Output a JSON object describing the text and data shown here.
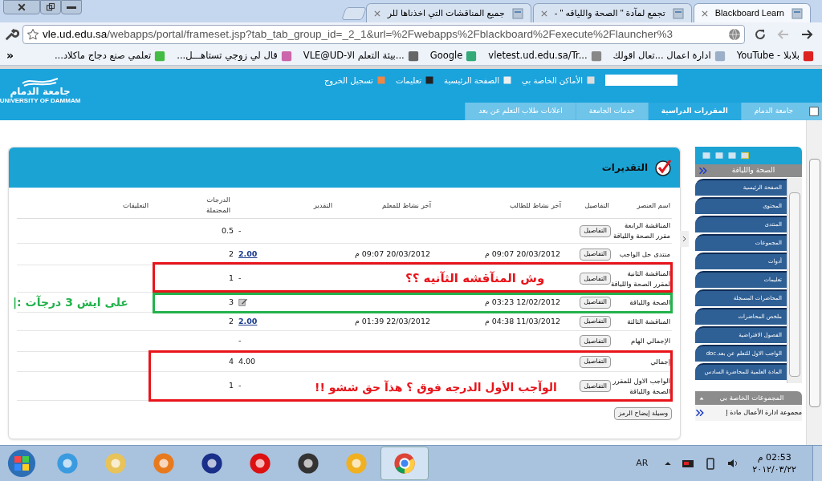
{
  "browser_tabs": [
    {
      "label": "Blackboard Learn",
      "selected": true
    },
    {
      "label": "تجمع لمآدة \" الصحة واللياقه \" - ",
      "selected": false
    },
    {
      "label": "جميع المناقشات التي اخذناها للر",
      "selected": false
    }
  ],
  "address": {
    "host": "vle.ud.edu.sa",
    "path": "/webapps/portal/frameset.jsp?tab_tab_group_id=_2_1&url=%2Fwebapps%2Fblackboard%2Fexecute%2Flauncher%3"
  },
  "bookmarks": [
    {
      "label": "YouTube - بلابلا"
    },
    {
      "label": "ادارة اعمال ...تعال اقولك"
    },
    {
      "label": "vletest.ud.edu.sa/Tr..."
    },
    {
      "label": "Google"
    },
    {
      "label": "VLE@UD-بيئة التعلم الا..."
    },
    {
      "label": "قال لي زوجي تستاهـــل..."
    },
    {
      "label": "تعلمي صنع دجاج ماكلاد..."
    }
  ],
  "bookmarks_more": "»",
  "logo": {
    "arabic": "جامعة الدمام",
    "english": "UNIVERSITY OF DAMMAM"
  },
  "top_links": [
    "الأماكن الخاصة بي",
    "الصفحة الرئيسية",
    "تعليمات",
    "تسجيل الخروج"
  ],
  "portal_tabs": [
    {
      "label": "جامعة الدمام",
      "selected": false
    },
    {
      "label": "المقررات الدراسية",
      "selected": true
    },
    {
      "label": "خدمات الجامعة",
      "selected": false
    },
    {
      "label": "اعلانات طلاب التعلم عن بعد",
      "selected": false
    }
  ],
  "grades": {
    "title": "التقديرات",
    "columns": [
      "اسم العنصر",
      "التفاصيل",
      "آخر نشاط للطالب",
      "آخر نشاط للمعلم",
      "التقدير",
      "الدرجات المحتملة",
      "التعليقات"
    ],
    "rows": [
      {
        "name": "المناقشة الرابعة مقرر الصحة واللياقة",
        "details": "التفاصيل",
        "grade": {
          "kind": "text",
          "text": "-"
        },
        "possible": "0.5"
      },
      {
        "name": "منتدى حل الواجب",
        "details": "التفاصيل",
        "student": "20/03/2012 09:07 م",
        "teacher": "20/03/2012 09:07 م",
        "grade": {
          "kind": "link",
          "text": "2.00"
        },
        "possible": "2"
      },
      {
        "name": "المناقشة الثانية لمقرر الصحة واللياقة",
        "details": "التفاصيل",
        "grade": {
          "kind": "text",
          "text": "-"
        },
        "possible": "1"
      },
      {
        "name": "الصحة واللياقة",
        "details": "التفاصيل",
        "student": "12/02/2012 03:23 م",
        "grade": {
          "kind": "icon"
        },
        "possible": "3"
      },
      {
        "name": "المناقشة الثالثة",
        "details": "التفاصيل",
        "student": "11/03/2012 04:38 م",
        "teacher": "22/03/2012 01:39 م",
        "grade": {
          "kind": "link",
          "text": "2.00"
        },
        "possible": "2"
      },
      {
        "name": "الإجمالي الهام",
        "details": "التفاصيل",
        "grade": {
          "kind": "text",
          "text": "-"
        }
      },
      {
        "name": "إجمالي",
        "details": "التفاصيل",
        "grade": {
          "kind": "text",
          "text": "4.00"
        },
        "possible": "4"
      },
      {
        "name": "الواجب الاول للمقرر الصحة واللياقة",
        "details": "التفاصيل",
        "grade": {
          "kind": "text",
          "text": "-"
        },
        "possible": "1"
      }
    ],
    "legend_button": "وسيلة إيضاح الرمز"
  },
  "annotations": [
    {
      "text": "وش المنآقشه الثآنيه ؟؟",
      "color": "#e8141b"
    },
    {
      "text": "على ايش 3 درجآت :|",
      "color": "#22b24c"
    },
    {
      "text": "الوآجب الأول الدرجه فوق ؟ هذآ حق ششو !!",
      "color": "#e8141b"
    }
  ],
  "course_menu": {
    "title": "الصحة واللياقة",
    "items": [
      "الصفحة الرئيسية",
      "المحتوى",
      "المنتدى",
      "المجموعات",
      "أدوات",
      "تعليمات",
      "المحاضرات المسجلة",
      "ملخص المحاضرات",
      "الفصول الافتراضية",
      "الواجب الاول للتعلم عن بعد.doc",
      "المادة العلمية للمحاضرة السادس"
    ]
  },
  "my_groups": {
    "title": "المجموعات الخاصة بي",
    "items": [
      "مجموعة ادارة الأعمال مادة إ"
    ]
  },
  "taskbar": {
    "language": "AR",
    "time": "02:53 م",
    "date": "٢٠١٢/٠٣/٢٢"
  }
}
